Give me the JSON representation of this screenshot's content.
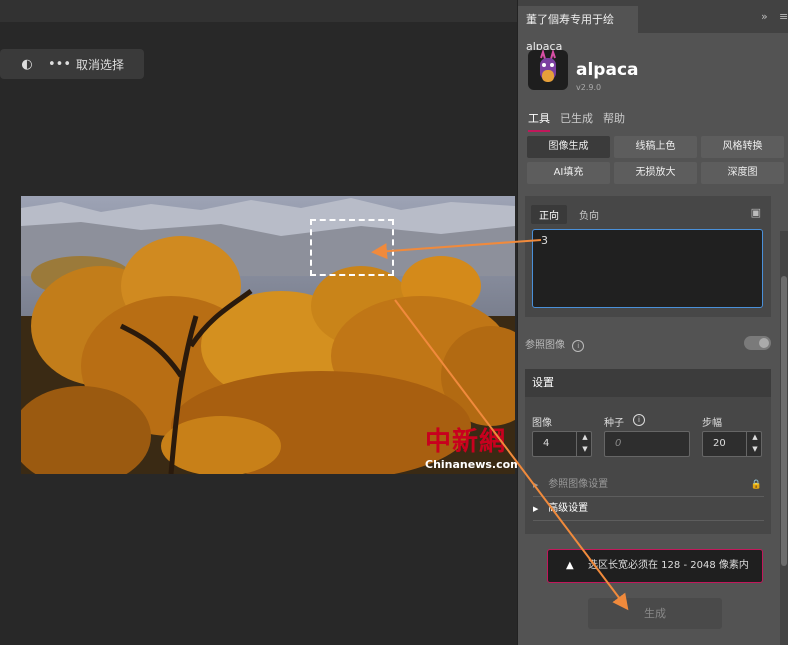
{
  "context_bar": {
    "icons": [
      "contrast-icon",
      "more-icon"
    ],
    "cancel_selection": "取消选择"
  },
  "canvas": {
    "watermark_cn": "中新網",
    "watermark_en": "Chinanews.com"
  },
  "panel": {
    "tab_title": "董了個寿专用于绘alpaca",
    "collapse_glyph": "»",
    "menu_glyph": "≡",
    "app_name": "alpaca",
    "version": "v2.9.0",
    "tabs": [
      "工具",
      "已生成",
      "帮助"
    ],
    "tools": [
      "图像生成",
      "线稿上色",
      "风格转换",
      "AI填充",
      "无损放大",
      "深度图"
    ],
    "prompt": {
      "positive_label": "正向",
      "negative_label": "负向",
      "text": "3"
    },
    "reference_image_label": "参照图像",
    "settings": {
      "title": "设置",
      "image_label": "图像",
      "image_value": "4",
      "seed_label": "种子",
      "seed_placeholder": "0",
      "steps_label": "步幅",
      "steps_value": "20",
      "ref_settings_label": "参照图像设置",
      "advanced_label": "高级设置"
    },
    "warning_text": "选区长宽必须在 128 - 2048 像素内",
    "warning_glyph": "▲",
    "generate_label": "生成"
  },
  "colors": {
    "accent": "#c2185b",
    "focus_border": "#4a90d9",
    "annotation_arrow": "#f08a3c"
  }
}
